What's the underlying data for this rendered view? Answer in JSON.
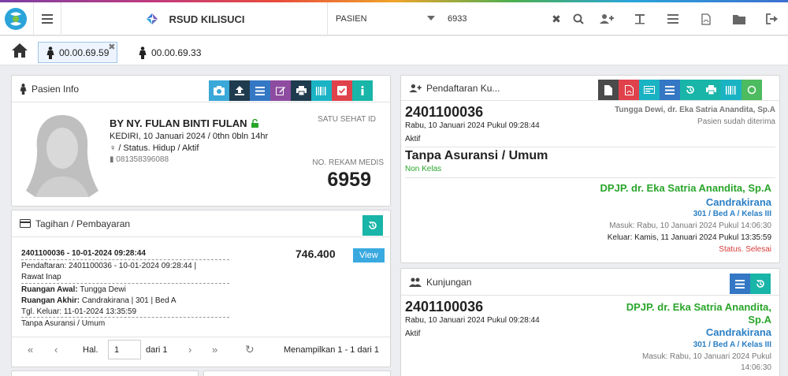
{
  "navbar": {
    "brand": "RSUD KILISUCI",
    "search_category": "PASIEN",
    "search_value": "6933",
    "colors": {
      "accent": "#18b5a8",
      "blue": "#3477c4",
      "red": "#e0424b"
    }
  },
  "tabs": [
    {
      "label": "00.00.69.59",
      "active": true
    },
    {
      "label": "00.00.69.33",
      "active": false
    }
  ],
  "pasien_info": {
    "title": "Pasien Info",
    "name": "BY NY. FULAN BINTI FULAN",
    "birth": "KEDIRI, 10 Januari 2024 / 0thn 0bln 14hr",
    "status": "/ Status. Hidup / Aktif",
    "phone": "081358396088",
    "satu_sehat_label": "SATU SEHAT ID",
    "rm_label": "NO. REKAM MEDIS",
    "rm_number": "6959"
  },
  "tagihan": {
    "title": "Tagihan / Pembayaran",
    "header": "2401100036 - 10-01-2024 09:28:44",
    "amount": "746.400",
    "view_label": "View",
    "pendaftaran": "Pendaftaran: 2401100036 - 10-01-2024 09:28:44 |",
    "jenis": "Rawat Inap",
    "ruangan_awal_label": "Ruangan Awal:",
    "ruangan_awal": "Tungga Dewi",
    "ruangan_akhir_label": "Ruangan Akhir:",
    "ruangan_akhir": "Candrakirana | 301 | Bed A",
    "tgl_keluar": "Tgl. Keluar: 11-01-2024 13:35:59",
    "penjamin": "Tanpa Asuransi / Umum",
    "pager": {
      "hal": "Hal.",
      "page": "1",
      "dari": "dari 1",
      "info": "Menampilkan 1 - 1 dari 1"
    }
  },
  "pendaftaran": {
    "title": "Pendaftaran Ku...",
    "reg_no": "2401100036",
    "reg_date": "Rabu, 10 Januari 2024 Pukul 09:28:44",
    "room_doc": "Tungga Dewi, dr. Eka Satria Anandita, Sp.A",
    "accepted": "Pasien sudah diterima",
    "aktif": "Aktif",
    "penjamin": "Tanpa Asuransi / Umum",
    "kelas": "Non Kelas",
    "dpjp": "DPJP. dr. Eka Satria Anandita, Sp.A",
    "ruang": "Candrakirana",
    "bed": "301 / Bed A / Kelas III",
    "masuk": "Masuk: Rabu, 10 Januari 2024 Pukul 14:06:30",
    "keluar": "Keluar: Kamis, 11 Januari 2024 Pukul 13:35:59",
    "status": "Status. Selesai"
  },
  "kunjungan": {
    "title": "Kunjungan",
    "reg_no": "2401100036",
    "reg_date": "Rabu, 10 Januari 2024 Pukul 09:28:44",
    "aktif": "Aktif",
    "dpjp_line1": "DPJP. dr. Eka Satria Anandita,",
    "dpjp_line2": "Sp.A",
    "ruang": "Candrakirana",
    "bed": "301 / Bed A / Kelas III",
    "masuk_line1": "Masuk: Rabu, 10 Januari 2024 Pukul",
    "masuk_line2": "14:06:30"
  }
}
